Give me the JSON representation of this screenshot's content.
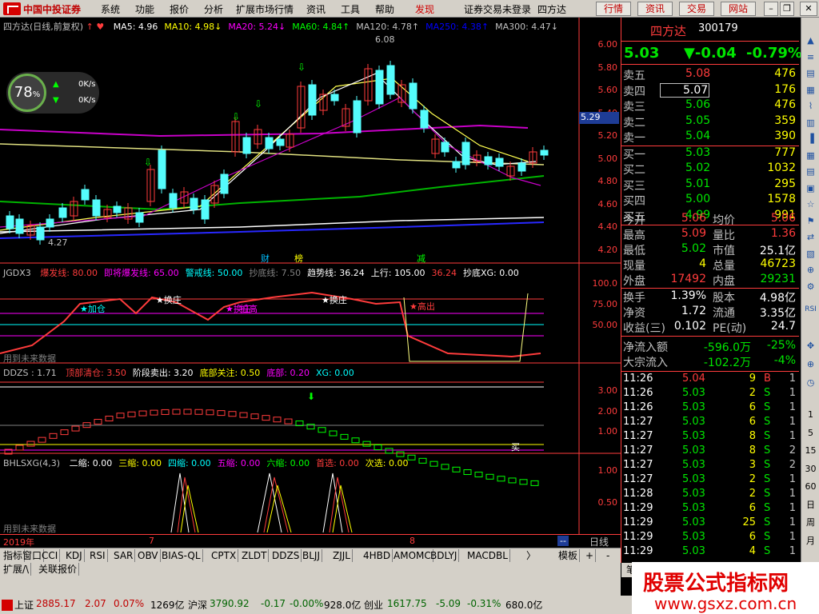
{
  "menu": {
    "brand": "中国中投证券",
    "items": [
      "系统",
      "功能",
      "报价",
      "分析",
      "扩展市场行情",
      "资讯",
      "工具",
      "帮助"
    ],
    "hot": "发现",
    "status": "证券交易未登录",
    "stock_name": "四方达",
    "buttons": [
      "行情",
      "资讯",
      "交易",
      "网站"
    ]
  },
  "main": {
    "title": "四方达(日线,前复权)",
    "ma": [
      {
        "label": "MA5: 4.96",
        "color": "#ffffff"
      },
      {
        "label": "MA10: 4.98↓",
        "color": "#ffff00"
      },
      {
        "label": "MA20: 5.24↓",
        "color": "#ff00ff"
      },
      {
        "label": "MA60: 4.84↑",
        "color": "#00ff00"
      },
      {
        "label": "MA120: 4.78↑",
        "color": "#c0c0c0"
      },
      {
        "label": "MA250: 4.38↑",
        "color": "#0000ff"
      },
      {
        "label": "MA300: 4.47↓",
        "color": "#c0c0c0"
      }
    ],
    "yticks": [
      "6.00",
      "5.80",
      "5.60",
      "5.40",
      "5.20",
      "5.00",
      "4.80",
      "4.60",
      "4.40",
      "4.20"
    ],
    "price_tag": "5.29",
    "high_mark": "6.08",
    "low_mark": "4.27",
    "events": [
      "财",
      "榜",
      "减"
    ]
  },
  "gauge": {
    "value": "78",
    "unit": "%",
    "up": "0K/s",
    "down": "0K/s"
  },
  "jgdx": {
    "title": "JGDX3",
    "items": [
      {
        "label": "爆发线: 80.00",
        "color": "#ff3c3c"
      },
      {
        "label": "即将爆发线: 65.00",
        "color": "#ff00ff"
      },
      {
        "label": "警戒线: 50.00",
        "color": "#00ffff"
      },
      {
        "label": "抄底线: 7.50",
        "color": "#808080"
      },
      {
        "label": "趋势线: 36.24",
        "color": "#ffffff"
      },
      {
        "label": "上行: 105.00",
        "color": "#ffffff"
      },
      {
        "label": "36.24",
        "color": "#ff3c3c"
      },
      {
        "label": "抄底XG: 0.00",
        "color": "#ffffff"
      }
    ],
    "yticks": [
      "100.0",
      "75.00",
      "50.00"
    ],
    "labels": [
      "加仓",
      "换庄",
      "换庄",
      "拉高",
      "换庄",
      "高出"
    ],
    "future": "用到未来数据"
  },
  "ddzs": {
    "title": "DDZS : 1.71",
    "items": [
      {
        "label": "顶部清仓: 3.50",
        "color": "#ff3c3c"
      },
      {
        "label": "阶段卖出: 3.20",
        "color": "#ffffff"
      },
      {
        "label": "底部关注: 0.50",
        "color": "#ffff00"
      },
      {
        "label": "底部: 0.20",
        "color": "#ff00ff"
      },
      {
        "label": "XG: 0.00",
        "color": "#00ffff"
      }
    ],
    "yticks": [
      "3.00",
      "2.00",
      "1.00"
    ],
    "buy": "买"
  },
  "bhl": {
    "title": "BHLSXG(4,3)",
    "items": [
      {
        "label": "二缩: 0.00",
        "color": "#ffffff"
      },
      {
        "label": "三缩: 0.00",
        "color": "#ffff00"
      },
      {
        "label": "四缩: 0.00",
        "color": "#00ffff"
      },
      {
        "label": "五缩: 0.00",
        "color": "#ff00ff"
      },
      {
        "label": "六缩: 0.00",
        "color": "#00ff00"
      },
      {
        "label": "首选: 0.00",
        "color": "#ff3c3c"
      },
      {
        "label": "次选: 0.00",
        "color": "#ffff00"
      }
    ],
    "yticks": [
      "1.00",
      "0.50"
    ],
    "future": "用到未来数据"
  },
  "dates": {
    "year": "2019年",
    "m7": "7",
    "m8": "8",
    "period": "日线",
    "dash": "--"
  },
  "tabs": [
    "指标",
    "窗口",
    "CCI",
    "KDJ",
    "RSI",
    "SAR",
    "OBV",
    "BIAS-QL",
    "CPTX",
    "ZLDT",
    "DDZS",
    "BLJJ",
    "ZJJL",
    "4HBD",
    "AMOMC",
    "BDLYJ",
    "MACDBL"
  ],
  "tabs_right": [
    "模板",
    "+",
    "-"
  ],
  "tabs2": [
    "扩展",
    "关联报价"
  ],
  "quote": {
    "name": "四方达",
    "code": "300179",
    "price": "5.03",
    "change": "▼-0.04",
    "pct": "-0.79%",
    "asks": [
      {
        "l": "卖五",
        "p": "5.08",
        "v": "476",
        "pc": "red"
      },
      {
        "l": "卖四",
        "p": "5.07",
        "v": "176",
        "pc": "white"
      },
      {
        "l": "卖三",
        "p": "5.06",
        "v": "476",
        "pc": "green"
      },
      {
        "l": "卖二",
        "p": "5.05",
        "v": "359",
        "pc": "green"
      },
      {
        "l": "卖一",
        "p": "5.04",
        "v": "390",
        "pc": "green"
      }
    ],
    "bids": [
      {
        "l": "买一",
        "p": "5.03",
        "v": "777",
        "pc": "green"
      },
      {
        "l": "买二",
        "p": "5.02",
        "v": "1032",
        "pc": "green"
      },
      {
        "l": "买三",
        "p": "5.01",
        "v": "295",
        "pc": "green"
      },
      {
        "l": "买四",
        "p": "5.00",
        "v": "1578",
        "pc": "green"
      },
      {
        "l": "买五",
        "p": "4.99",
        "v": "991",
        "pc": "green"
      }
    ],
    "stats": [
      {
        "l1": "今开",
        "v1": "5.06",
        "c1": "red",
        "l2": "均价",
        "v2": "5.06",
        "c2": "red"
      },
      {
        "l1": "最高",
        "v1": "5.09",
        "c1": "red",
        "l2": "量比",
        "v2": "1.36",
        "c2": "red"
      },
      {
        "l1": "最低",
        "v1": "5.02",
        "c1": "green",
        "l2": "市值",
        "v2": "25.1亿",
        "c2": "white"
      },
      {
        "l1": "现量",
        "v1": "4",
        "c1": "yellow",
        "l2": "总量",
        "v2": "46723",
        "c2": "yellow"
      },
      {
        "l1": "外盘",
        "v1": "17492",
        "c1": "red",
        "l2": "内盘",
        "v2": "29231",
        "c2": "green"
      }
    ],
    "stats2": [
      {
        "l1": "换手",
        "v1": "1.39%",
        "c1": "white",
        "l2": "股本",
        "v2": "4.98亿",
        "c2": "white"
      },
      {
        "l1": "净资",
        "v1": "1.72",
        "c1": "white",
        "l2": "流通",
        "v2": "3.35亿",
        "c2": "white"
      },
      {
        "l1": "收益(三)",
        "v1": "0.102",
        "c1": "white",
        "l2": "PE(动)",
        "v2": "24.7",
        "c2": "white"
      }
    ],
    "flows": [
      {
        "l": "净流入额",
        "v": "-596.0万",
        "p": "-25%"
      },
      {
        "l": "大宗流入",
        "v": "-102.2万",
        "p": "-4%"
      }
    ]
  },
  "ticks": [
    {
      "t": "11:26",
      "p": "5.04",
      "v": "9",
      "s": "B",
      "n": "1"
    },
    {
      "t": "11:26",
      "p": "5.03",
      "v": "2",
      "s": "S",
      "n": "1"
    },
    {
      "t": "11:26",
      "p": "5.03",
      "v": "6",
      "s": "S",
      "n": "1"
    },
    {
      "t": "11:27",
      "p": "5.03",
      "v": "6",
      "s": "S",
      "n": "1"
    },
    {
      "t": "11:27",
      "p": "5.03",
      "v": "8",
      "s": "S",
      "n": "1"
    },
    {
      "t": "11:27",
      "p": "5.03",
      "v": "8",
      "s": "S",
      "n": "2"
    },
    {
      "t": "11:27",
      "p": "5.03",
      "v": "3",
      "s": "S",
      "n": "2"
    },
    {
      "t": "11:27",
      "p": "5.03",
      "v": "2",
      "s": "S",
      "n": "1"
    },
    {
      "t": "11:28",
      "p": "5.03",
      "v": "2",
      "s": "S",
      "n": "1"
    },
    {
      "t": "11:29",
      "p": "5.03",
      "v": "6",
      "s": "S",
      "n": "1"
    },
    {
      "t": "11:29",
      "p": "5.03",
      "v": "25",
      "s": "S",
      "n": "1"
    },
    {
      "t": "11:29",
      "p": "5.03",
      "v": "6",
      "s": "S",
      "n": "1"
    },
    {
      "t": "11:29",
      "p": "5.03",
      "v": "4",
      "s": "S",
      "n": "1"
    }
  ],
  "right_bottom": "笔",
  "sidetool": [
    "RSI",
    "1",
    "5",
    "15",
    "30",
    "60",
    "日",
    "周",
    "月"
  ],
  "status": {
    "sh_label": "上证",
    "sh_val": "2885.17",
    "sh_chg": "2.07",
    "sh_pct": "0.07%",
    "sh_amt": "1269亿",
    "sz_label": "沪深",
    "sz_val": "3790.92",
    "sz_chg": "-0.17",
    "sz_pct": "-0.00%",
    "sz_amt": "928.0亿",
    "cy_label": "创业",
    "cy_val": "1617.75",
    "cy_chg": "-5.09",
    "cy_pct": "-0.31%",
    "cy_amt": "680.0亿"
  },
  "watermark": {
    "title": "股票公式指标网",
    "url": "www.gsxz.com.cn"
  },
  "colors": {
    "up": "#ff3c3c",
    "down": "#00ffff",
    "accent": "#d00000"
  }
}
